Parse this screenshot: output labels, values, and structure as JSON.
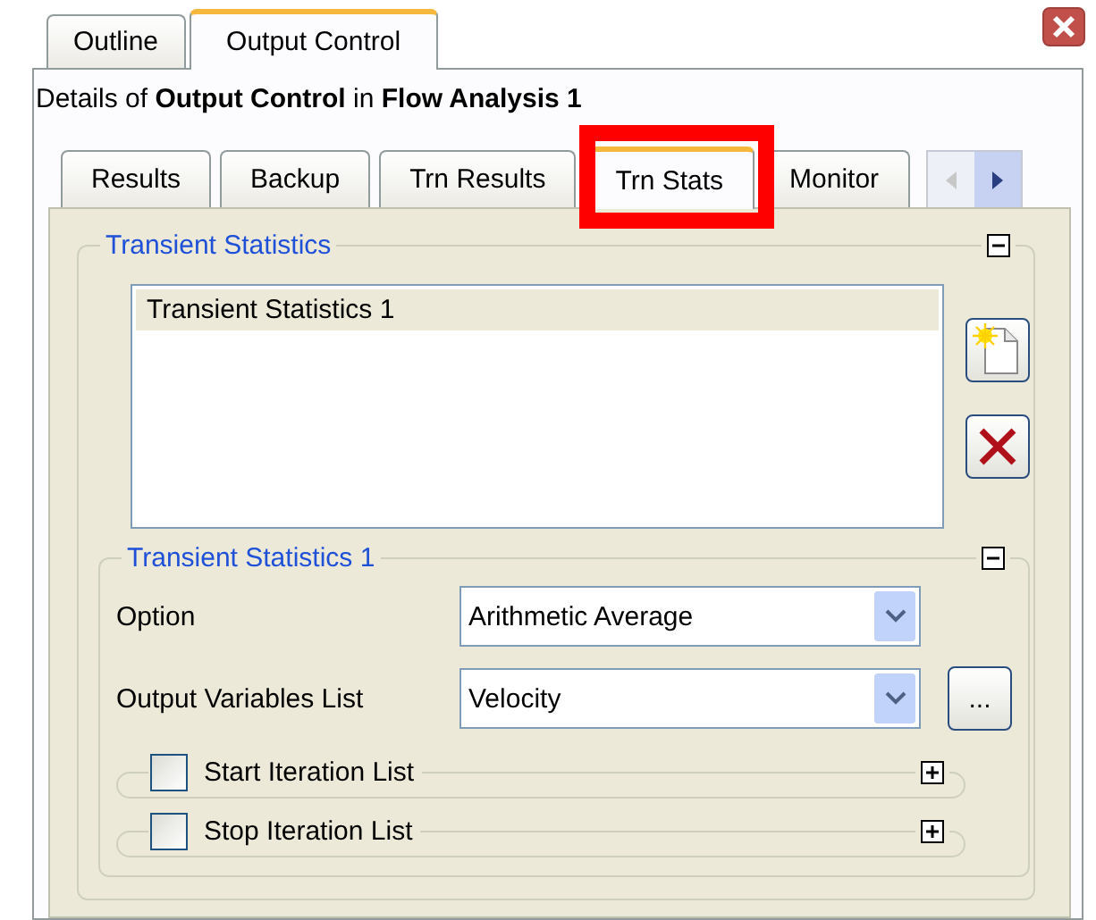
{
  "outer_tabs": [
    {
      "label": "Outline",
      "selected": false
    },
    {
      "label": "Output Control",
      "selected": true
    }
  ],
  "details": "Details of **Output Control** in **Flow Analysis 1**",
  "inner_tabs": [
    {
      "label": "Results",
      "selected": false,
      "highlighted": false
    },
    {
      "label": "Backup",
      "selected": false,
      "highlighted": false
    },
    {
      "label": "Trn Results",
      "selected": false,
      "highlighted": false
    },
    {
      "label": "Trn Stats",
      "selected": true,
      "highlighted": true
    },
    {
      "label": "Monitor",
      "selected": false,
      "highlighted": false
    }
  ],
  "transient_statistics": {
    "title": "Transient Statistics",
    "expanded": true,
    "list": [
      {
        "label": "Transient Statistics 1",
        "selected": true
      }
    ],
    "detail": {
      "title": "Transient Statistics 1",
      "expanded": true,
      "fields": [
        {
          "label": "Option",
          "value": "Arithmetic Average",
          "kind": "dropdown"
        },
        {
          "label": "Output Variables List",
          "value": "Velocity",
          "kind": "dropdown-browse",
          "browse_label": "..."
        }
      ],
      "options": [
        {
          "label": "Start Iteration List",
          "checked": false,
          "expanded": false
        },
        {
          "label": "Stop Iteration List",
          "checked": false,
          "expanded": false
        }
      ]
    }
  }
}
